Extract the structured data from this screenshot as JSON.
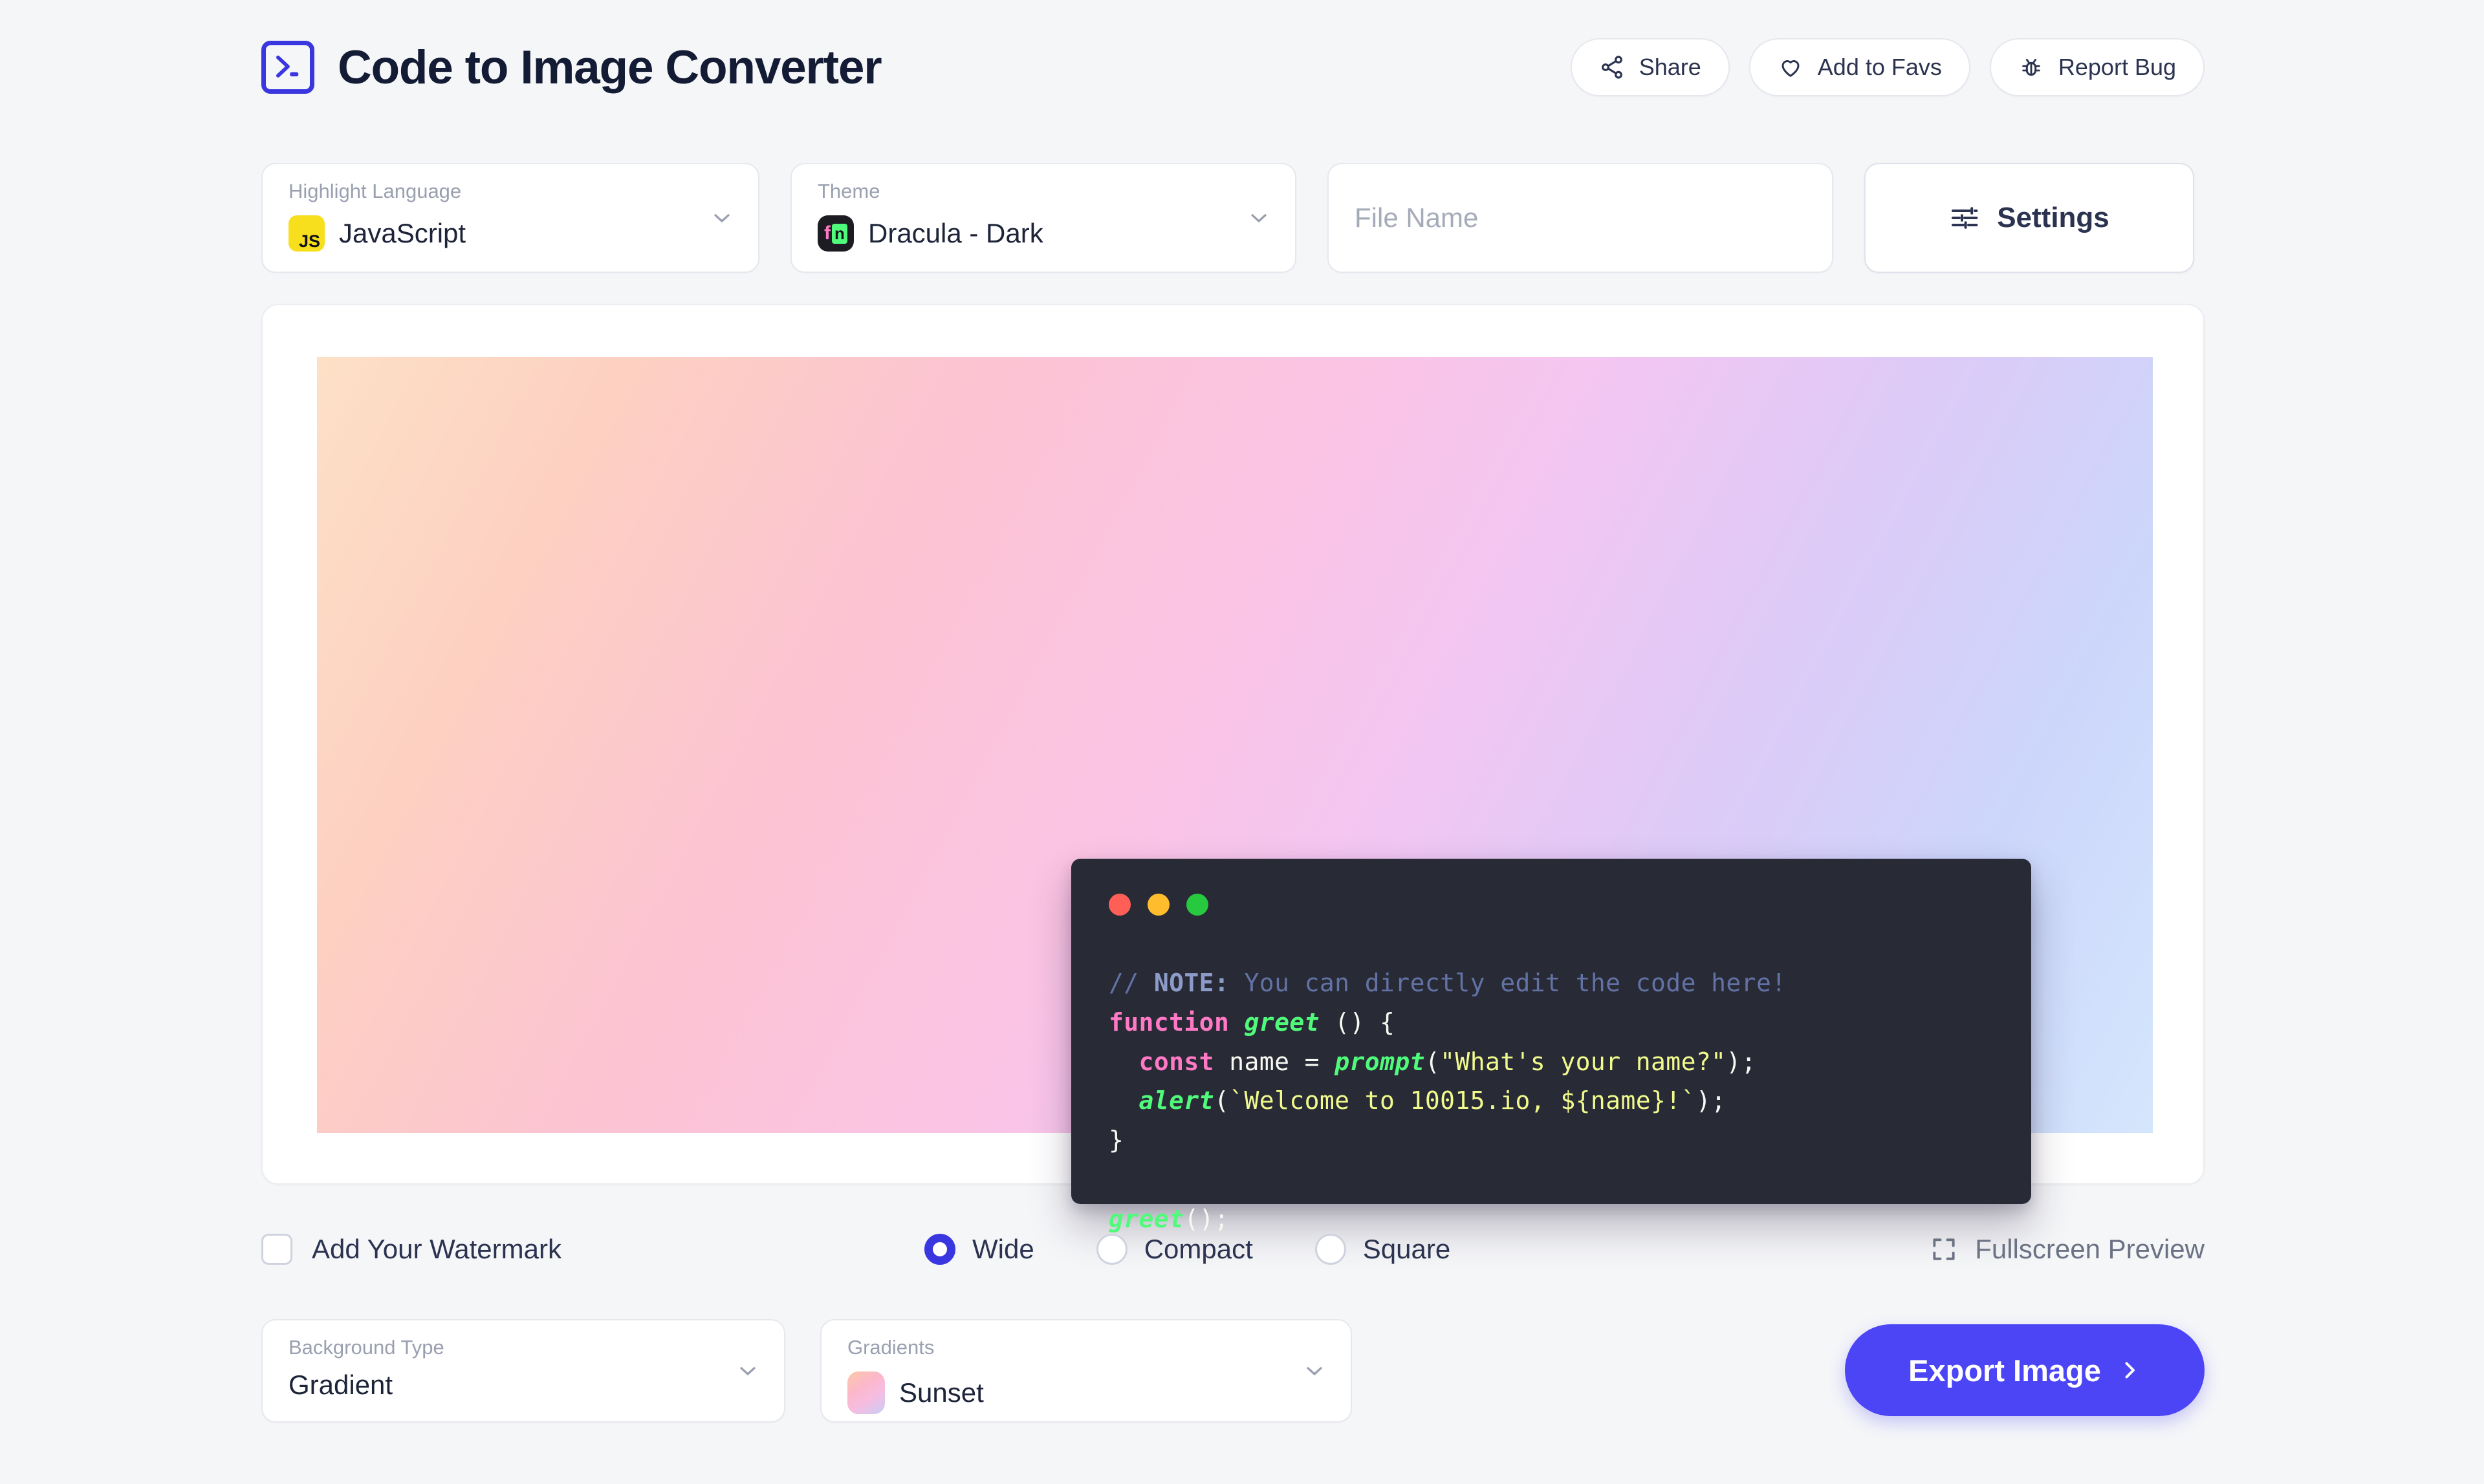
{
  "app": {
    "title": "Code to Image Converter",
    "logo_icon": "terminal-prompt-icon",
    "accent_color": "#4b45f5",
    "logo_color": "#3a36e0",
    "page_background": "#f5f6f8"
  },
  "header": {
    "actions": [
      {
        "label": "Share",
        "icon": "share-icon"
      },
      {
        "label": "Add to Favs",
        "icon": "heart-icon"
      },
      {
        "label": "Report Bug",
        "icon": "bug-icon"
      }
    ]
  },
  "controls": {
    "language": {
      "label": "Highlight Language",
      "value": "JavaScript",
      "badge_text": "JS",
      "badge_color": "#f7df1e",
      "chevron": "chevron-down-icon"
    },
    "theme": {
      "label": "Theme",
      "value": "Dracula - Dark",
      "badge_text_1": "f",
      "badge_text_2": "n",
      "chevron": "chevron-down-icon"
    },
    "file_name": {
      "placeholder": "File Name",
      "value": ""
    },
    "settings": {
      "label": "Settings",
      "icon": "sliders-icon"
    }
  },
  "preview": {
    "gradient_name": "Sunset",
    "window_background": "#282a36",
    "dots": [
      {
        "name": "close-dot",
        "color": "#ff5f56"
      },
      {
        "name": "minimize-dot",
        "color": "#ffbd2e"
      },
      {
        "name": "maximize-dot",
        "color": "#27c93f"
      }
    ],
    "code_lines": [
      [
        {
          "t": "// ",
          "c": "c-comment"
        },
        {
          "t": "NOTE:",
          "c": "c-note"
        },
        {
          "t": " You can directly edit the code here!",
          "c": "c-comment"
        }
      ],
      [
        {
          "t": "function ",
          "c": "c-kw"
        },
        {
          "t": "greet ",
          "c": "c-fn"
        },
        {
          "t": "() {",
          "c": "c-plain"
        }
      ],
      [
        {
          "t": "  const ",
          "c": "c-kw"
        },
        {
          "t": "name = ",
          "c": "c-plain"
        },
        {
          "t": "prompt",
          "c": "c-fn"
        },
        {
          "t": "(",
          "c": "c-plain"
        },
        {
          "t": "\"What's your name?\"",
          "c": "c-str"
        },
        {
          "t": ");",
          "c": "c-plain"
        }
      ],
      [
        {
          "t": "  alert",
          "c": "c-fn"
        },
        {
          "t": "(",
          "c": "c-plain"
        },
        {
          "t": "`Welcome to 10015.io, ${name}!`",
          "c": "c-str"
        },
        {
          "t": ");",
          "c": "c-plain"
        }
      ],
      [
        {
          "t": "}",
          "c": "c-plain"
        }
      ],
      [
        {
          "t": "",
          "c": "c-plain"
        }
      ],
      [
        {
          "t": "greet",
          "c": "c-fn"
        },
        {
          "t": "();",
          "c": "c-plain"
        }
      ]
    ]
  },
  "options": {
    "watermark_label": "Add Your Watermark",
    "watermark_checked": false,
    "layouts": [
      {
        "label": "Wide",
        "selected": true
      },
      {
        "label": "Compact",
        "selected": false
      },
      {
        "label": "Square",
        "selected": false
      }
    ],
    "fullscreen_label": "Fullscreen Preview",
    "fullscreen_icon": "expand-icon"
  },
  "bottom": {
    "background_type": {
      "label": "Background Type",
      "value": "Gradient",
      "chevron": "chevron-down-icon"
    },
    "gradients": {
      "label": "Gradients",
      "value": "Sunset",
      "chevron": "chevron-down-icon"
    },
    "export": {
      "label": "Export Image",
      "icon": "chevron-right-icon"
    }
  }
}
